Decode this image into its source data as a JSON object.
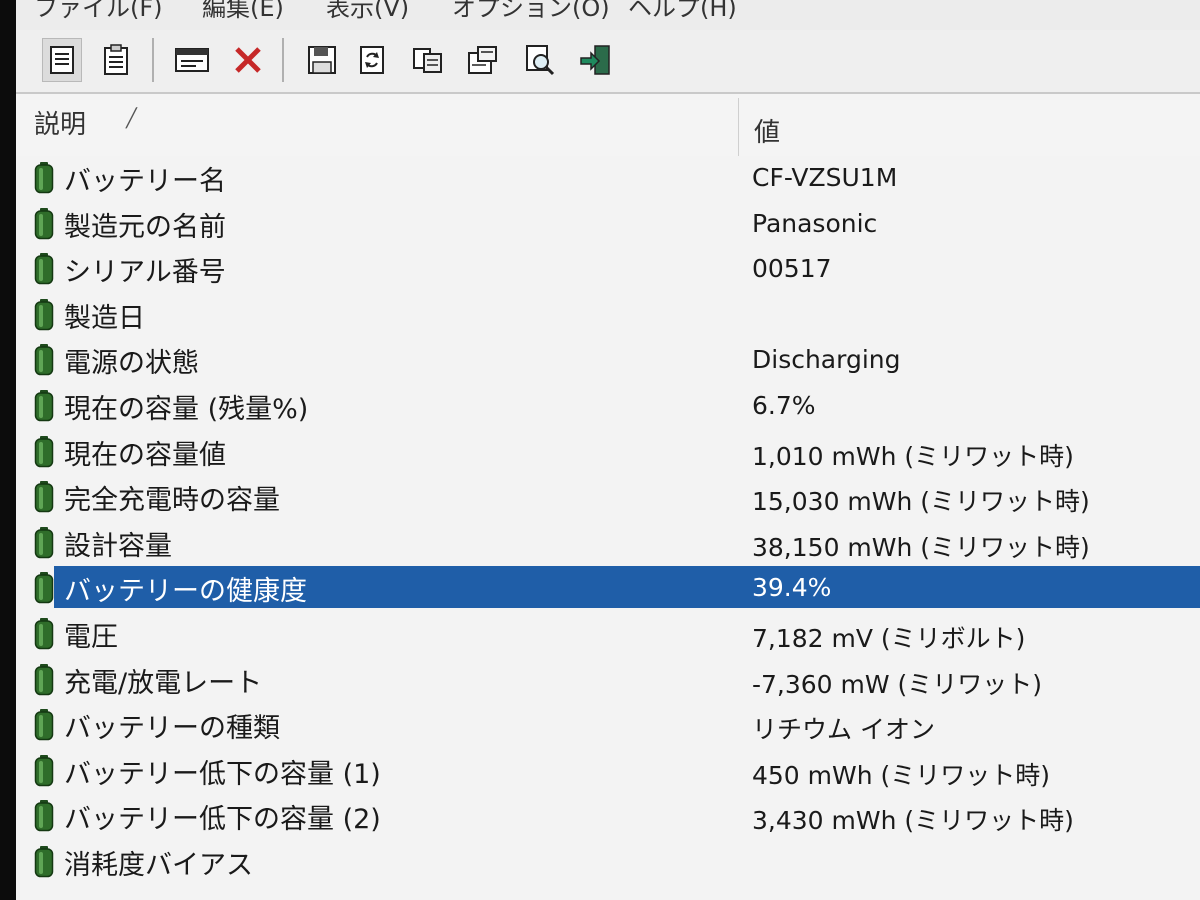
{
  "menu": [
    "ファイル(F)",
    "編集(E)",
    "表示(V)",
    "オプション(O)",
    "ヘルプ(H)"
  ],
  "toolbar": {
    "buttons": [
      "view-details-icon",
      "view-report-icon",
      "properties-icon",
      "delete-icon",
      "save-icon",
      "refresh-icon",
      "copy-icon",
      "html-report-icon",
      "find-icon",
      "exit-icon"
    ]
  },
  "columns": {
    "description": "説明",
    "value": "値"
  },
  "rows": [
    {
      "label": "バッテリー名",
      "value": "CF-VZSU1M"
    },
    {
      "label": "製造元の名前",
      "value": "Panasonic"
    },
    {
      "label": "シリアル番号",
      "value": "00517"
    },
    {
      "label": "製造日",
      "value": ""
    },
    {
      "label": "電源の状態",
      "value": "Discharging"
    },
    {
      "label": "現在の容量 (残量%)",
      "value": "6.7%"
    },
    {
      "label": "現在の容量値",
      "value": "1,010 mWh (ミリワット時)"
    },
    {
      "label": "完全充電時の容量",
      "value": "15,030 mWh (ミリワット時)"
    },
    {
      "label": "設計容量",
      "value": "38,150 mWh (ミリワット時)"
    },
    {
      "label": "バッテリーの健康度",
      "value": "39.4%",
      "selected": true
    },
    {
      "label": "電圧",
      "value": "7,182 mV (ミリボルト)"
    },
    {
      "label": "充電/放電レート",
      "value": "-7,360 mW (ミリワット)"
    },
    {
      "label": "バッテリーの種類",
      "value": "リチウム イオン"
    },
    {
      "label": "バッテリー低下の容量 (1)",
      "value": "450 mWh (ミリワット時)"
    },
    {
      "label": "バッテリー低下の容量 (2)",
      "value": "3,430 mWh (ミリワット時)"
    },
    {
      "label": "消耗度バイアス",
      "value": ""
    }
  ],
  "colors": {
    "selection": "#1f5ea8",
    "battery_icon": "#2f6d2a"
  }
}
